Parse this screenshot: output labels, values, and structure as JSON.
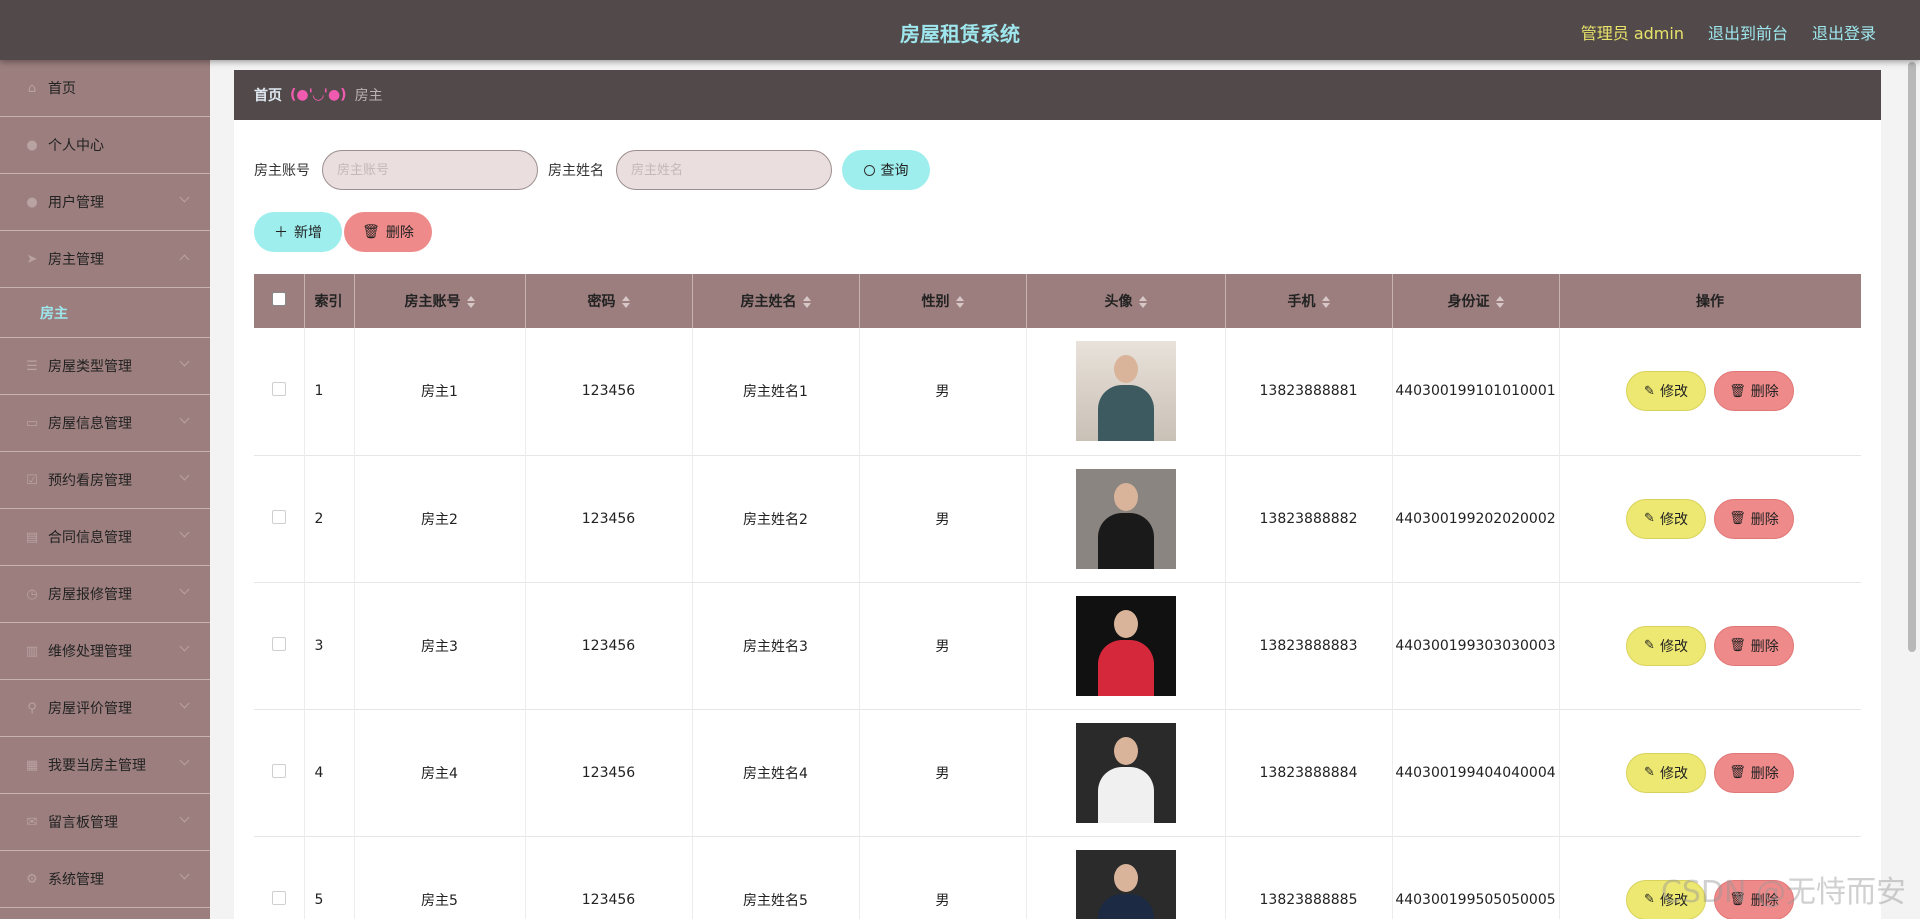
{
  "header": {
    "title": "房屋租赁系统",
    "admin_label": "管理员 admin",
    "front_link": "退出到前台",
    "logout_link": "退出登录"
  },
  "sidebar": {
    "items": [
      {
        "label": "首页",
        "icon": "home-icon"
      },
      {
        "label": "个人中心",
        "icon": "user-icon"
      },
      {
        "label": "用户管理",
        "icon": "user-icon"
      },
      {
        "label": "房主管理",
        "icon": "send-icon",
        "expanded": true
      },
      {
        "label": "房屋类型管理",
        "icon": "list-icon"
      },
      {
        "label": "房屋信息管理",
        "icon": "card-icon"
      },
      {
        "label": "预约看房管理",
        "icon": "check-icon"
      },
      {
        "label": "合同信息管理",
        "icon": "stack-icon"
      },
      {
        "label": "房屋报修管理",
        "icon": "clock-icon"
      },
      {
        "label": "维修处理管理",
        "icon": "chart-icon"
      },
      {
        "label": "房屋评价管理",
        "icon": "pin-icon"
      },
      {
        "label": "我要当房主管理",
        "icon": "doc-icon"
      },
      {
        "label": "留言板管理",
        "icon": "mail-icon"
      },
      {
        "label": "系统管理",
        "icon": "gear-icon"
      }
    ],
    "sub_item": "房主"
  },
  "breadcrumb": {
    "home": "首页",
    "separator": "(●'◡'●)",
    "current": "房主"
  },
  "search": {
    "account_label": "房主账号",
    "account_placeholder": "房主账号",
    "account_value": "",
    "name_label": "房主姓名",
    "name_placeholder": "房主姓名",
    "name_value": "",
    "query_label": "查询"
  },
  "actions": {
    "add_label": "新增",
    "delete_label": "删除"
  },
  "table": {
    "columns": [
      "索引",
      "房主账号",
      "密码",
      "房主姓名",
      "性别",
      "头像",
      "手机",
      "身份证",
      "操作"
    ],
    "edit_label": "修改",
    "delete_label": "删除",
    "rows": [
      {
        "index": "1",
        "account": "房主1",
        "password": "123456",
        "name": "房主姓名1",
        "gender": "男",
        "phone": "13823888881",
        "id_card": "440300199101010001"
      },
      {
        "index": "2",
        "account": "房主2",
        "password": "123456",
        "name": "房主姓名2",
        "gender": "男",
        "phone": "13823888882",
        "id_card": "440300199202020002"
      },
      {
        "index": "3",
        "account": "房主3",
        "password": "123456",
        "name": "房主姓名3",
        "gender": "男",
        "phone": "13823888883",
        "id_card": "440300199303030003"
      },
      {
        "index": "4",
        "account": "房主4",
        "password": "123456",
        "name": "房主姓名4",
        "gender": "男",
        "phone": "13823888884",
        "id_card": "440300199404040004"
      },
      {
        "index": "5",
        "account": "房主5",
        "password": "123456",
        "name": "房主姓名5",
        "gender": "男",
        "phone": "13823888885",
        "id_card": "440300199505050005"
      }
    ]
  },
  "watermark": "CSDN @无恃而安",
  "colors": {
    "topbar": "#524a4a",
    "sidebar": "#9c7e7e",
    "accent_cyan": "#9eeeee",
    "accent_yellow": "#ede872",
    "accent_red": "#ef8a8a"
  }
}
